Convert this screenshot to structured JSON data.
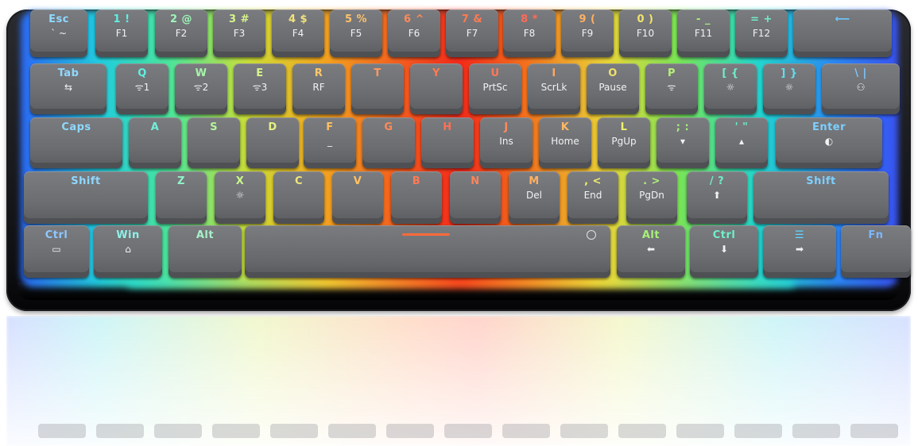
{
  "keyboard": {
    "case_color": "#111216",
    "keycap_color": "#6e7074",
    "rows": [
      [
        {
          "id": "esc",
          "top": "Esc",
          "sub": "` ~",
          "color": "#8fd8ff"
        },
        {
          "id": "1",
          "top": "1 !",
          "sub": "F1",
          "color": "#5ff0e0"
        },
        {
          "id": "2",
          "top": "2 @",
          "sub": "F2",
          "color": "#9ff6b8"
        },
        {
          "id": "3",
          "top": "3 #",
          "sub": "F3",
          "color": "#d7f58a"
        },
        {
          "id": "4",
          "top": "4 $",
          "sub": "F4",
          "color": "#f3e27a"
        },
        {
          "id": "5",
          "top": "5 %",
          "sub": "F5",
          "color": "#ffc26a"
        },
        {
          "id": "6",
          "top": "6 ^",
          "sub": "F6",
          "color": "#ff8a5a"
        },
        {
          "id": "7",
          "top": "7 &",
          "sub": "F7",
          "color": "#ff7a52"
        },
        {
          "id": "8",
          "top": "8 *",
          "sub": "F8",
          "color": "#ff6a56"
        },
        {
          "id": "9",
          "top": "9 (",
          "sub": "F9",
          "color": "#ffb060"
        },
        {
          "id": "0",
          "top": "0 )",
          "sub": "F10",
          "color": "#f0e46a"
        },
        {
          "id": "minus",
          "top": "- _",
          "sub": "F11",
          "color": "#a8f078"
        },
        {
          "id": "equal",
          "top": "= +",
          "sub": "F12",
          "color": "#6ff0c8"
        },
        {
          "id": "backspace",
          "top": "⟵",
          "sub": "",
          "color": "#6fc8ff"
        }
      ],
      [
        {
          "id": "tab",
          "top": "Tab",
          "sub": "⇆",
          "color": "#8fd8ff"
        },
        {
          "id": "q",
          "top": "Q",
          "sub": "ᯤ1",
          "color": "#5ff0e0"
        },
        {
          "id": "w",
          "top": "W",
          "sub": "ᯤ2",
          "color": "#a6f5a8"
        },
        {
          "id": "e",
          "top": "E",
          "sub": "ᯤ3",
          "color": "#d9f58a"
        },
        {
          "id": "r",
          "top": "R",
          "sub": "RF",
          "color": "#ffc86a"
        },
        {
          "id": "t",
          "top": "T",
          "sub": "",
          "color": "#ff9a5e"
        },
        {
          "id": "y",
          "top": "Y",
          "sub": "",
          "color": "#ff7a52"
        },
        {
          "id": "u",
          "top": "U",
          "sub": "PrtSc",
          "color": "#ff7858"
        },
        {
          "id": "i",
          "top": "I",
          "sub": "ScrLk",
          "color": "#ffa860"
        },
        {
          "id": "o",
          "top": "O",
          "sub": "Pause",
          "color": "#f0e06a"
        },
        {
          "id": "p",
          "top": "P",
          "sub": "ᯤ",
          "color": "#b8f078"
        },
        {
          "id": "lbracket",
          "top": "[ {",
          "sub": "☼",
          "color": "#6ff0c8"
        },
        {
          "id": "rbracket",
          "top": "] }",
          "sub": "☼",
          "color": "#5fe0f0"
        },
        {
          "id": "backslash",
          "top": "\\ |",
          "sub": "⚇",
          "color": "#7cc8ff"
        }
      ],
      [
        {
          "id": "caps",
          "top": "Caps",
          "sub": "",
          "color": "#8fd8ff"
        },
        {
          "id": "a",
          "top": "A",
          "sub": "",
          "color": "#6ff0d8"
        },
        {
          "id": "s",
          "top": "S",
          "sub": "",
          "color": "#b6f59a"
        },
        {
          "id": "d",
          "top": "D",
          "sub": "",
          "color": "#e6f080"
        },
        {
          "id": "f",
          "top": "F",
          "sub": "_",
          "color": "#ffc062"
        },
        {
          "id": "g",
          "top": "G",
          "sub": "",
          "color": "#ff8a58"
        },
        {
          "id": "h",
          "top": "H",
          "sub": "",
          "color": "#ff7052"
        },
        {
          "id": "j",
          "top": "J",
          "sub": "Ins",
          "color": "#ff8a5c"
        },
        {
          "id": "k",
          "top": "K",
          "sub": "Home",
          "color": "#ffb864"
        },
        {
          "id": "l",
          "top": "L",
          "sub": "PgUp",
          "color": "#eef06c"
        },
        {
          "id": "semicolon",
          "top": "; :",
          "sub": "▾",
          "color": "#a8f07a"
        },
        {
          "id": "quote",
          "top": "' \"",
          "sub": "▴",
          "color": "#6ff0c8"
        },
        {
          "id": "enter",
          "top": "Enter",
          "sub": "◐",
          "color": "#7cd0ff"
        }
      ],
      [
        {
          "id": "lshift",
          "top": "Shift",
          "sub": "",
          "color": "#8fd8ff"
        },
        {
          "id": "z",
          "top": "Z",
          "sub": "",
          "color": "#8ff2c8"
        },
        {
          "id": "x",
          "top": "X",
          "sub": "☼",
          "color": "#c8f58a"
        },
        {
          "id": "c",
          "top": "C",
          "sub": "",
          "color": "#f0e878"
        },
        {
          "id": "v",
          "top": "V",
          "sub": "",
          "color": "#ffc062"
        },
        {
          "id": "b",
          "top": "B",
          "sub": "",
          "color": "#ff7a54"
        },
        {
          "id": "n",
          "top": "N",
          "sub": "",
          "color": "#ff8458"
        },
        {
          "id": "m",
          "top": "M",
          "sub": "Del",
          "color": "#ffb060"
        },
        {
          "id": "comma",
          "top": ", <",
          "sub": "End",
          "color": "#f2ea6a"
        },
        {
          "id": "period",
          "top": ". >",
          "sub": "PgDn",
          "color": "#b0f078"
        },
        {
          "id": "slash",
          "top": "/ ?",
          "sub": "⬆",
          "color": "#6ff0c8"
        },
        {
          "id": "rshift",
          "top": "Shift",
          "sub": "",
          "color": "#7cd0ff"
        }
      ],
      [
        {
          "id": "lctrl",
          "top": "Ctrl",
          "sub": "▭",
          "color": "#8fc8ff"
        },
        {
          "id": "win",
          "top": "Win",
          "sub": "⌂",
          "color": "#8ff0e8"
        },
        {
          "id": "lalt",
          "top": "Alt",
          "sub": "",
          "color": "#a8f0c8"
        },
        {
          "id": "space",
          "top": "",
          "sub": "",
          "color": "#ffffff"
        },
        {
          "id": "ralt",
          "top": "Alt",
          "sub": "⬅",
          "color": "#a8f078"
        },
        {
          "id": "rctrl",
          "top": "Ctrl",
          "sub": "⬇",
          "color": "#6ff0c8"
        },
        {
          "id": "menu",
          "top": "☰",
          "sub": "➡",
          "color": "#5fd8ff"
        },
        {
          "id": "fn",
          "top": "Fn",
          "sub": "",
          "color": "#7cb8ff"
        }
      ]
    ]
  }
}
